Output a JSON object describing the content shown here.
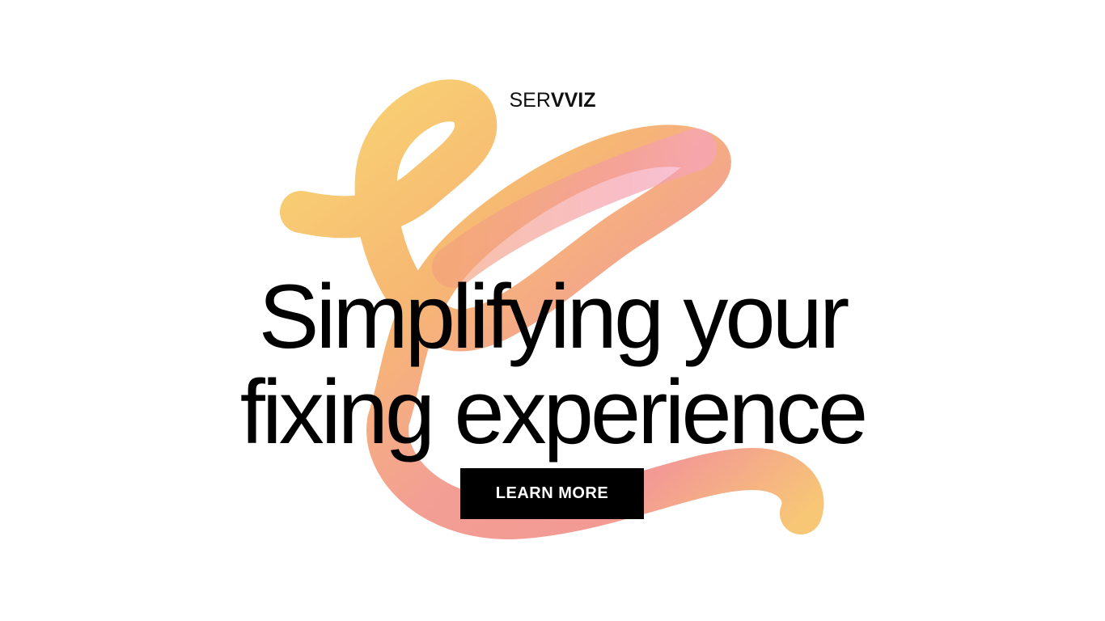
{
  "brand": {
    "logo_light": "SER",
    "logo_bold": "VVIZ"
  },
  "hero": {
    "headline_line1": "Simplifying your",
    "headline_line2": "fixing experience",
    "cta_label": "LEARN MORE"
  },
  "colors": {
    "background": "#ffffff",
    "text": "#000000",
    "button_bg": "#000000",
    "button_text": "#ffffff",
    "ribbon_yellow": "#f7c96b",
    "ribbon_orange": "#f5a36f",
    "ribbon_pink": "#f39aa8"
  }
}
